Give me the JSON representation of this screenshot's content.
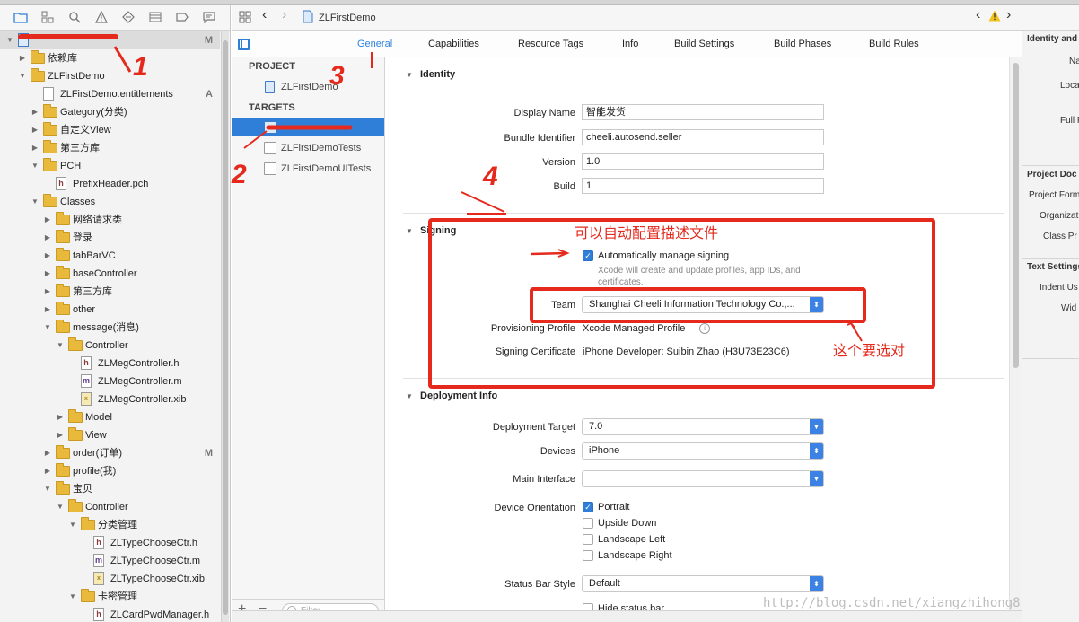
{
  "navigator": {
    "rows": [
      {
        "label": "",
        "badge": "M"
      },
      {
        "label": "依赖库",
        "badge": ""
      },
      {
        "label": "ZLFirstDemo",
        "badge": ""
      },
      {
        "label": "ZLFirstDemo.entitlements",
        "badge": "A"
      },
      {
        "label": "Gategory(分类)",
        "badge": ""
      },
      {
        "label": "自定义View",
        "badge": ""
      },
      {
        "label": "第三方库",
        "badge": ""
      },
      {
        "label": "PCH",
        "badge": ""
      },
      {
        "label": "PrefixHeader.pch",
        "badge": ""
      },
      {
        "label": "Classes",
        "badge": ""
      },
      {
        "label": "网络请求类",
        "badge": ""
      },
      {
        "label": "登录",
        "badge": ""
      },
      {
        "label": "tabBarVC",
        "badge": ""
      },
      {
        "label": "baseController",
        "badge": ""
      },
      {
        "label": "第三方库",
        "badge": ""
      },
      {
        "label": "other",
        "badge": ""
      },
      {
        "label": "message(消息)",
        "badge": ""
      },
      {
        "label": "Controller",
        "badge": ""
      },
      {
        "label": "ZLMegController.h",
        "badge": ""
      },
      {
        "label": "ZLMegController.m",
        "badge": ""
      },
      {
        "label": "ZLMegController.xib",
        "badge": ""
      },
      {
        "label": "Model",
        "badge": ""
      },
      {
        "label": "View",
        "badge": ""
      },
      {
        "label": "order(订单)",
        "badge": "M"
      },
      {
        "label": "profile(我)",
        "badge": ""
      },
      {
        "label": "宝贝",
        "badge": ""
      },
      {
        "label": "Controller",
        "badge": ""
      },
      {
        "label": "分类管理",
        "badge": ""
      },
      {
        "label": "ZLTypeChooseCtr.h",
        "badge": ""
      },
      {
        "label": "ZLTypeChooseCtr.m",
        "badge": ""
      },
      {
        "label": "ZLTypeChooseCtr.xib",
        "badge": ""
      },
      {
        "label": "卡密管理",
        "badge": ""
      },
      {
        "label": "ZLCardPwdManager.h",
        "badge": ""
      }
    ]
  },
  "jumpbar": {
    "title": "ZLFirstDemo"
  },
  "tabs": [
    "General",
    "Capabilities",
    "Resource Tags",
    "Info",
    "Build Settings",
    "Build Phases",
    "Build Rules"
  ],
  "targets_list": {
    "project_header": "PROJECT",
    "project_item": "ZLFirstDemo",
    "targets_header": "TARGETS",
    "target_items": [
      "",
      "ZLFirstDemoTests",
      "ZLFirstDemoUITests"
    ],
    "filter_placeholder": "Filter"
  },
  "identity": {
    "header": "Identity",
    "display_name_label": "Display Name",
    "display_name": "智能发货",
    "bundle_id_label": "Bundle Identifier",
    "bundle_id": "cheeli.autosend.seller",
    "version_label": "Version",
    "version": "1.0",
    "build_label": "Build",
    "build": "1"
  },
  "signing": {
    "header": "Signing",
    "auto_label": "Automatically manage signing",
    "auto_note": "Xcode will create and update profiles, app IDs, and certificates.",
    "team_label": "Team",
    "team": "Shanghai Cheeli Information Technology Co.,...",
    "profile_label": "Provisioning Profile",
    "profile": "Xcode Managed Profile",
    "cert_label": "Signing Certificate",
    "cert": "iPhone Developer: Suibin Zhao (H3U73E23C6)"
  },
  "deployment": {
    "header": "Deployment Info",
    "target_label": "Deployment Target",
    "target": "7.0",
    "devices_label": "Devices",
    "devices": "iPhone",
    "main_interface_label": "Main Interface",
    "main_interface": "",
    "orientation_label": "Device Orientation",
    "orientations": [
      {
        "label": "Portrait",
        "checked": true
      },
      {
        "label": "Upside Down",
        "checked": false
      },
      {
        "label": "Landscape Left",
        "checked": false
      },
      {
        "label": "Landscape Right",
        "checked": false
      }
    ],
    "status_bar_label": "Status Bar Style",
    "status_bar": "Default",
    "hide_status_bar": "Hide status bar"
  },
  "inspector": {
    "h1": "Identity and",
    "labels1": [
      "Na",
      "Locati",
      "Full P"
    ],
    "h2": "Project Doc",
    "labels2": [
      "Project Form",
      "Organizati",
      "Class Pr"
    ],
    "h3": "Text Settings",
    "labels3": [
      "Indent Us",
      "Wid"
    ]
  },
  "annotations": {
    "n1": "1",
    "n2": "2",
    "n3": "3",
    "n4": "4",
    "auto_config": "可以自动配置描述文件",
    "select_right": "这个要选对",
    "color": "#e52a1d"
  },
  "watermark": "http://blog.csdn.net/xiangzhihong8"
}
